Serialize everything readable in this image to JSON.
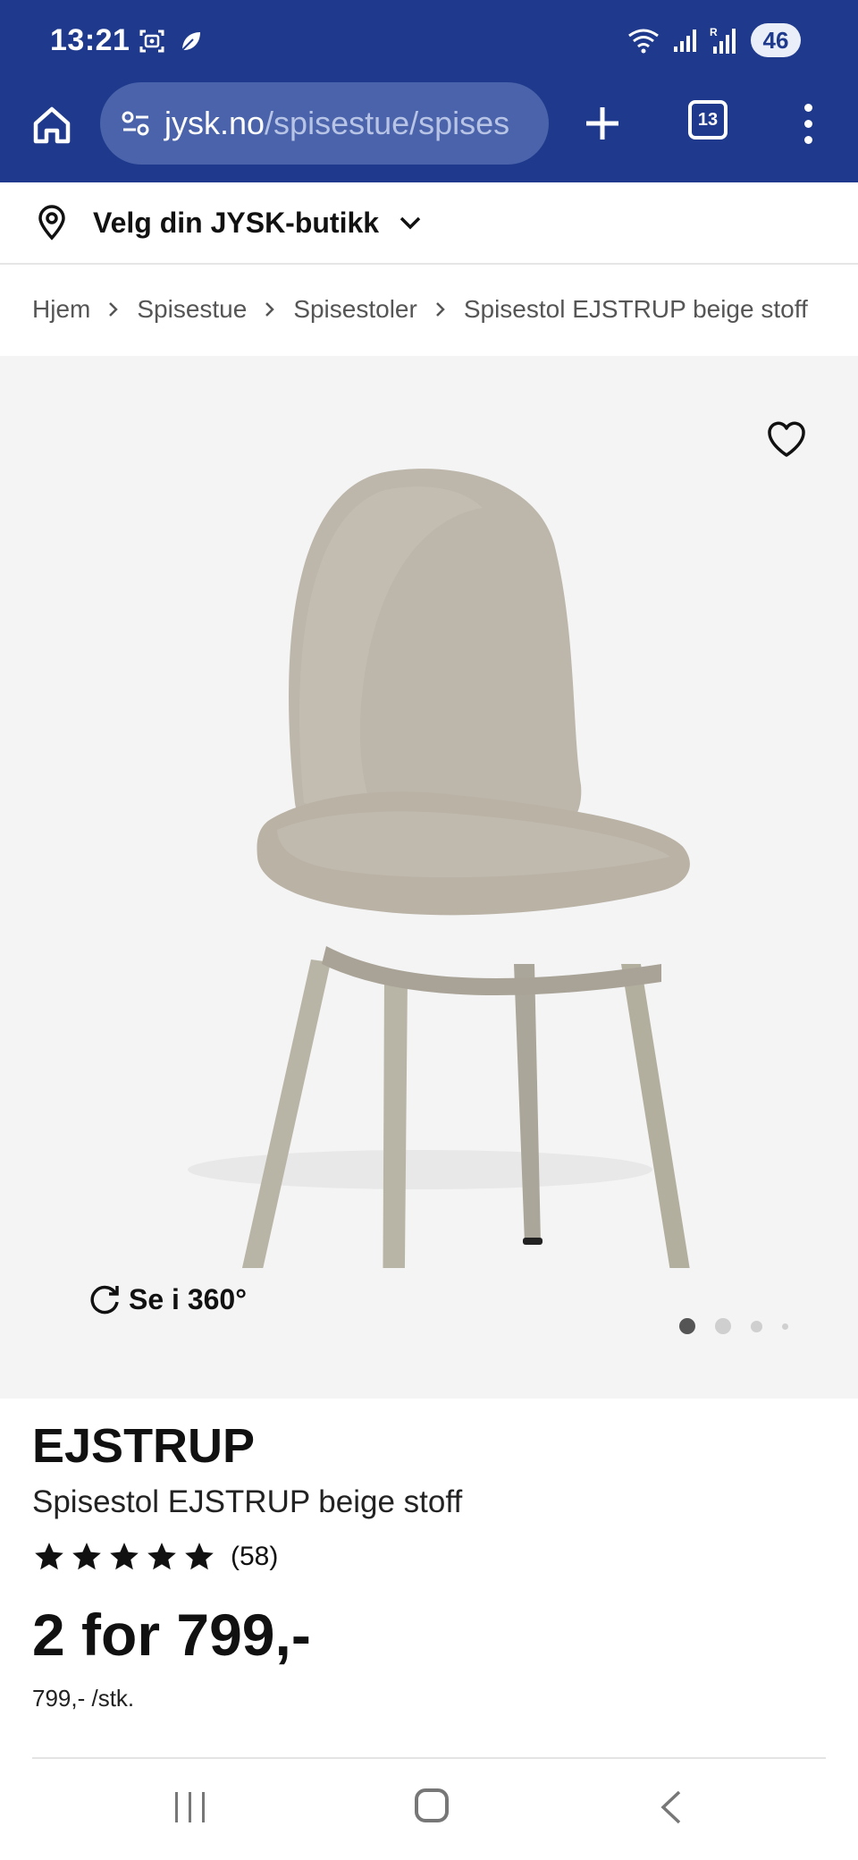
{
  "status_bar": {
    "time": "13:21",
    "battery": "46",
    "icons": [
      "screenshot-icon",
      "leaf-icon",
      "wifi-icon",
      "signal-icon",
      "signal-roaming-icon"
    ]
  },
  "browser": {
    "url_domain": "jysk.no",
    "url_path": "/spisestue/spises",
    "tab_count": "13"
  },
  "store_selector": {
    "label": "Velg din JYSK-butikk"
  },
  "breadcrumb": [
    {
      "label": "Hjem"
    },
    {
      "label": "Spisestue"
    },
    {
      "label": "Spisestoler"
    },
    {
      "label": "Spisestol EJSTRUP beige stoff"
    }
  ],
  "gallery": {
    "view_360_label": "Se i 360°",
    "image_count": 4,
    "active_index": 0
  },
  "product": {
    "brand": "EJSTRUP",
    "name": "Spisestol EJSTRUP beige stoff",
    "rating": 5,
    "review_count": "(58)",
    "price": "2 for 799,-",
    "unit_price": "799,- /stk."
  },
  "colors": {
    "chrome_blue": "#1f3a8c",
    "url_bar": "#4a63aa",
    "gallery_bg": "#f4f4f4",
    "chair_fabric": "#bdb6aa",
    "chair_legs": "#b9b5a6"
  }
}
